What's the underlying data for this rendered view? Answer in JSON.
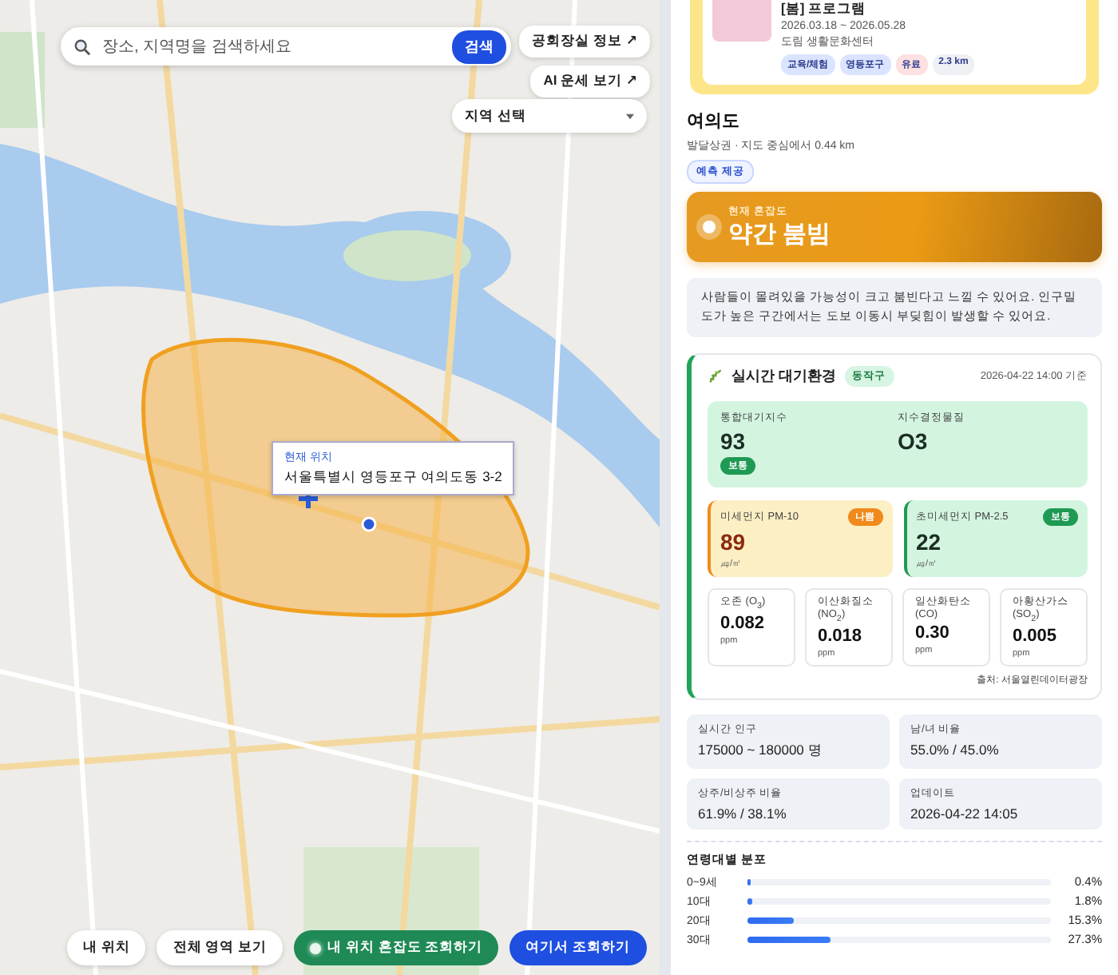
{
  "search": {
    "placeholder": "장소, 지역명을 검색하세요",
    "button": "검색"
  },
  "map_links": [
    {
      "label": "공회장실 정보 ↗"
    },
    {
      "label": "AI 운세 보기 ↗"
    }
  ],
  "region_select": {
    "label": "지역 선택"
  },
  "location_popup": {
    "title": "현재 위치",
    "address": "서울특별시 영등포구 여의도동 3-2"
  },
  "map_buttons": [
    {
      "label": "내 위치",
      "kind": "plain"
    },
    {
      "label": "전체 영역 보기",
      "kind": "plain"
    },
    {
      "label": "내 위치 혼잡도 조회하기",
      "kind": "green"
    },
    {
      "label": "여기서 조회하기",
      "kind": "blue"
    }
  ],
  "event_card": {
    "title": "[봄] 프로그램",
    "dates": "2026.03.18 ~ 2026.05.28",
    "venue": "도림 생활문화센터",
    "tags": [
      {
        "label": "교육/체험",
        "color": "#dbe4ff"
      },
      {
        "label": "영등포구",
        "color": "#dbe4ff"
      },
      {
        "label": "유료",
        "color": "#fde0e0"
      },
      {
        "label": "2.3 km",
        "color": "#eef0f4"
      }
    ]
  },
  "place": {
    "name": "여의도",
    "subtitle": "발달상권 · 지도 중심에서 0.44 km",
    "badge": "예측 제공"
  },
  "congestion": {
    "caption": "현재 혼잡도",
    "level_text": "약간 붐빔"
  },
  "description": "사람들이 몰려있을 가능성이 크고 붐빈다고 느낄 수 있어요. 인구밀도가 높은 구간에서는 도보 이동시 부딪힘이 발생할 수 있어요.",
  "air": {
    "title": "실시간 대기환경",
    "district": "동작구",
    "timestamp": "2026-04-22 14:00 기준",
    "aqi": {
      "label": "통합대기지수",
      "value": "93",
      "grade": "보통"
    },
    "key_pollutant": {
      "label": "지수결정물질",
      "value": "O3"
    },
    "pm": [
      {
        "label": "미세먼지 PM-10",
        "value": "89",
        "unit": "㎍/㎥",
        "grade": "나쁨",
        "kind": "bad"
      },
      {
        "label": "초미세먼지 PM-2.5",
        "value": "22",
        "unit": "㎍/㎥",
        "grade": "보통",
        "kind": "normal"
      }
    ],
    "gases": [
      {
        "name": "오존 (O$_{3}$)",
        "value": "0.082",
        "unit": "ppm"
      },
      {
        "name": "이산화질소 (NO$_{2}$)",
        "value": "0.018",
        "unit": "ppm"
      },
      {
        "name": "일산화탄소 (CO)",
        "value": "0.30",
        "unit": "ppm"
      },
      {
        "name": "아황산가스 (SO$_{2}$)",
        "value": "0.005",
        "unit": "ppm"
      }
    ],
    "source": "출처: 서울열린데이터광장"
  },
  "stats": [
    {
      "label": "실시간 인구",
      "value": "175000 ~ 180000 명"
    },
    {
      "label": "남/녀 비율",
      "value": "55.0% / 45.0%"
    },
    {
      "label": "상주/비상주 비율",
      "value": "61.9% / 38.1%"
    },
    {
      "label": "업데이트",
      "value": "2026-04-22 14:05"
    }
  ],
  "age_distribution": {
    "title": "연령대별 분포",
    "rows": [
      {
        "label": "0~9세",
        "level": 0.004,
        "reading": "0.4%"
      },
      {
        "label": "10대",
        "level": 0.018,
        "reading": "1.8%"
      },
      {
        "label": "20대",
        "level": 0.153,
        "reading": "15.3%"
      },
      {
        "label": "30대",
        "level": 0.273,
        "reading": "27.3%"
      }
    ]
  }
}
